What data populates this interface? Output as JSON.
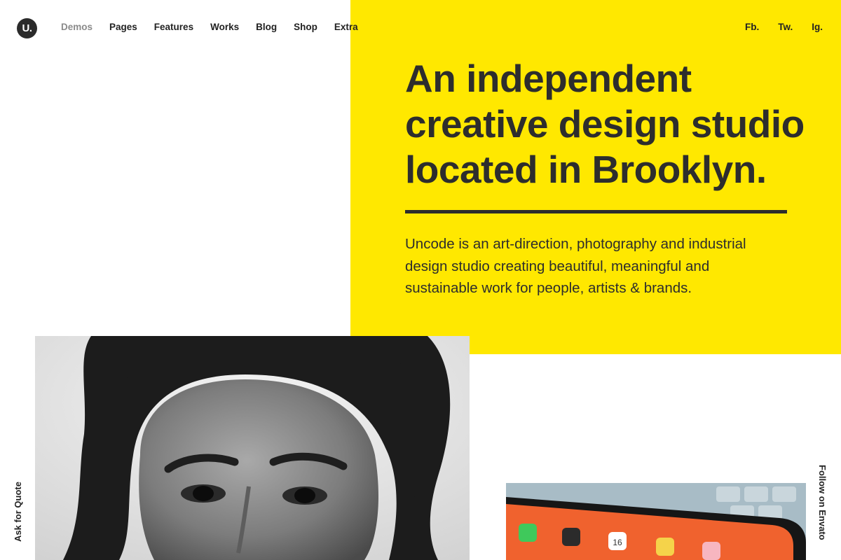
{
  "brand": {
    "logo_text": "U."
  },
  "nav": {
    "items": [
      {
        "label": "Demos"
      },
      {
        "label": "Pages"
      },
      {
        "label": "Features"
      },
      {
        "label": "Works"
      },
      {
        "label": "Blog"
      },
      {
        "label": "Shop"
      },
      {
        "label": "Extra"
      }
    ]
  },
  "social": {
    "items": [
      {
        "label": "Fb."
      },
      {
        "label": "Tw."
      },
      {
        "label": "Ig."
      }
    ]
  },
  "hero": {
    "headline": "An independent creative design studio located in Brooklyn.",
    "intro": "Uncode is an art-direction, photography and industrial design studio creating beautiful, meaningful and sustainable work for people, artists & brands."
  },
  "sidebar": {
    "left_label": "Ask for Quote",
    "right_label": "Follow on Envato"
  },
  "colors": {
    "accent_yellow": "#ffe800",
    "text_dark": "#2d2d2d",
    "nav_muted": "#8b8b8b"
  },
  "images": {
    "portrait": {
      "icon": "portrait-photo",
      "tone": "black-and-white"
    },
    "tablet": {
      "icon": "tablet-photo",
      "tone": "color",
      "calendar_day": "16"
    }
  }
}
